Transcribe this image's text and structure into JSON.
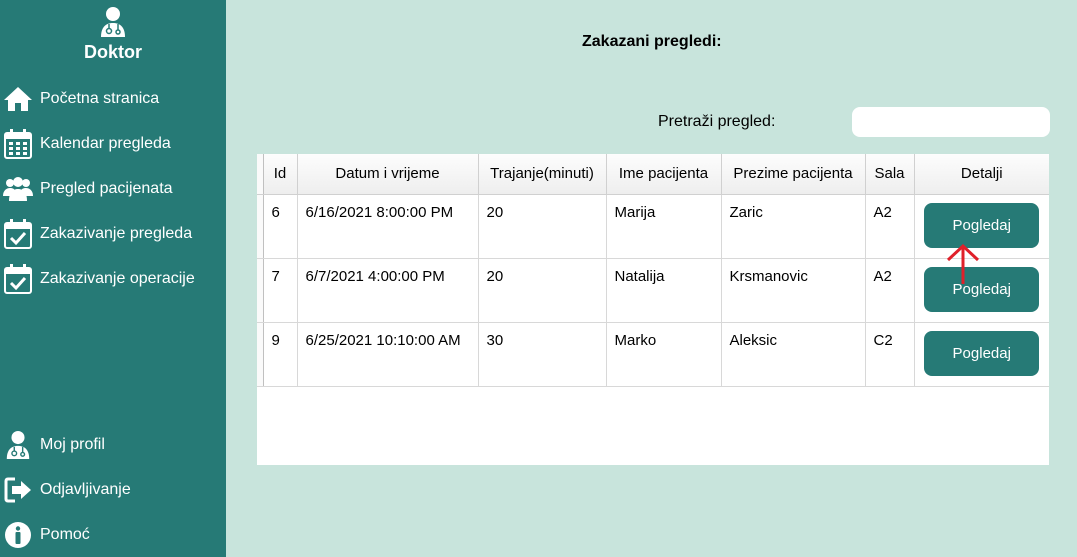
{
  "sidebar": {
    "brand": "Doktor",
    "items": [
      {
        "label": "Početna stranica",
        "icon": "home-icon"
      },
      {
        "label": "Kalendar pregleda",
        "icon": "calendar-icon"
      },
      {
        "label": "Pregled pacijenata",
        "icon": "patients-icon"
      },
      {
        "label": "Zakazivanje pregleda",
        "icon": "calendar-check-icon"
      },
      {
        "label": "Zakazivanje operacije",
        "icon": "calendar-check-icon"
      }
    ],
    "bottom": [
      {
        "label": "Moj profil",
        "icon": "doctor-icon"
      },
      {
        "label": "Odjavljivanje",
        "icon": "logout-icon"
      },
      {
        "label": "Pomoć",
        "icon": "info-icon"
      }
    ]
  },
  "main": {
    "title": "Zakazani pregledi:",
    "search_label": "Pretraži pregled:",
    "search_value": ""
  },
  "table": {
    "headers": [
      "Id",
      "Datum i vrijeme",
      "Trajanje(minuti)",
      "Ime pacijenta",
      "Prezime pacijenta",
      "Sala",
      "Detalji"
    ],
    "rows": [
      {
        "id": "6",
        "date": "6/16/2021 8:00:00 PM",
        "duration": "20",
        "first": "Marija",
        "last": "Zaric",
        "room": "A2",
        "action": "Pogledaj"
      },
      {
        "id": "7",
        "date": "6/7/2021 4:00:00 PM",
        "duration": "20",
        "first": "Natalija",
        "last": "Krsmanovic",
        "room": "A2",
        "action": "Pogledaj"
      },
      {
        "id": "9",
        "date": "6/25/2021 10:10:00 AM",
        "duration": "30",
        "first": "Marko",
        "last": "Aleksic",
        "room": "C2",
        "action": "Pogledaj"
      }
    ]
  },
  "colors": {
    "sidebar": "#267a76",
    "background": "#c8e4dc",
    "button": "#267a76",
    "annotation_arrow": "#e0202a"
  }
}
